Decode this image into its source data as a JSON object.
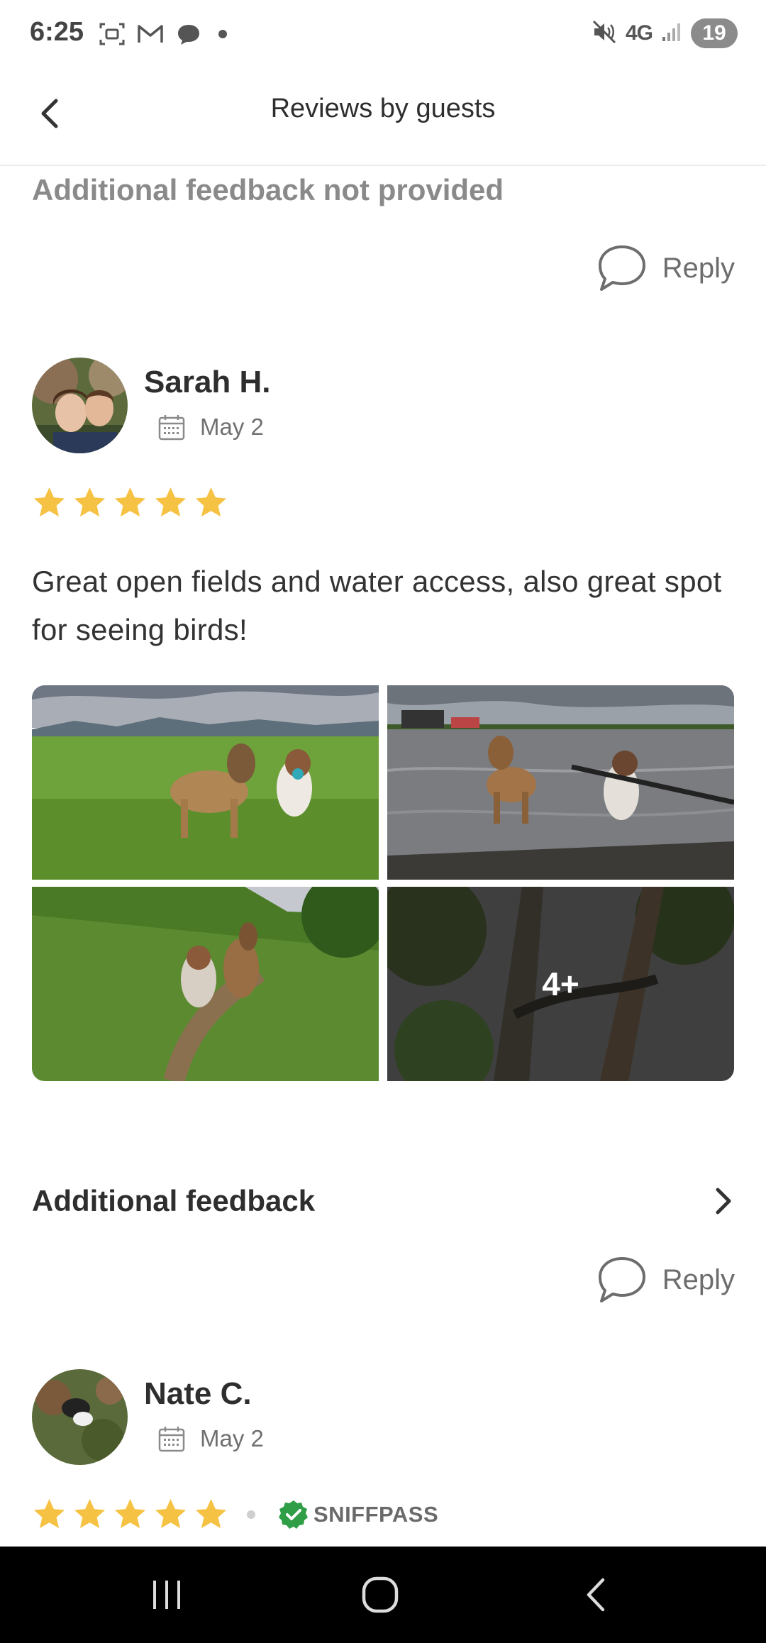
{
  "status_bar": {
    "time": "6:25",
    "network": "4G",
    "battery": "19",
    "icons": [
      "screenshot-icon",
      "gmail-icon",
      "chat-icon",
      "notification-dot",
      "mute-icon",
      "signal-icon"
    ]
  },
  "header": {
    "title": "Reviews by guests",
    "back_icon": "chevron-left-icon"
  },
  "previous_review": {
    "feedback_text": "Additional feedback not provided",
    "reply_label": "Reply"
  },
  "reviews": [
    {
      "name": "Sarah H.",
      "date": "May 2",
      "rating": 5,
      "text": "Great open fields and water access, also great spot for seeing birds!",
      "photos_more_label": "4+",
      "feedback_title": "Additional feedback",
      "reply_label": "Reply"
    },
    {
      "name": "Nate C.",
      "date": "May 2",
      "rating": 5,
      "badge": "SNIFFPASS"
    }
  ],
  "colors": {
    "star": "#f6c244",
    "badge_green": "#2f9e47",
    "nav_bar": "#000000"
  }
}
